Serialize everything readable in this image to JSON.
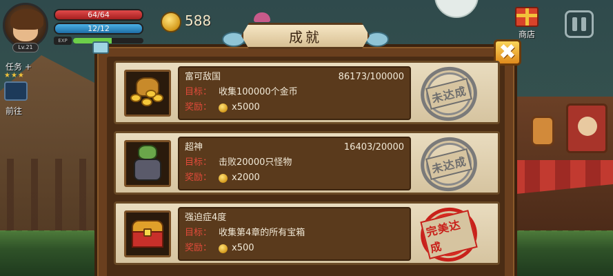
{
  "hud": {
    "level": "Lv.21",
    "hp_text": "64/64",
    "hp_fraction": 1.0,
    "mp_text": "12/12",
    "mp_fraction": 1.0,
    "exp_label": "EXP",
    "exp_fraction": 0.55,
    "coins": "588",
    "shop_label": "商店",
    "quest_label": "任务",
    "quest_add": "+",
    "stars": "★★★",
    "goto_label": "前往"
  },
  "panel": {
    "title": "成就",
    "close_glyph": "✖"
  },
  "achievements": [
    {
      "name": "富可敌国",
      "progress": "86173/100000",
      "goal_label": "目标：",
      "goal": "收集100000个金币",
      "reward_label": "奖励：",
      "reward": "x5000",
      "status": "未达成",
      "icon": "gold-pile-icon"
    },
    {
      "name": "超神",
      "progress": "16403/20000",
      "goal_label": "目标：",
      "goal": "击败20000只怪物",
      "reward_label": "奖励：",
      "reward": "x2000",
      "status": "未达成",
      "icon": "monster-icon"
    },
    {
      "name": "强迫症4度",
      "progress": "",
      "goal_label": "目标：",
      "goal": "收集第4章的所有宝箱",
      "reward_label": "奖励：",
      "reward": "x500",
      "status": "完美达成",
      "icon": "treasure-chest-icon"
    }
  ],
  "colors": {
    "hp": "#e04a4a",
    "mp": "#4ab0e4",
    "incomplete_stamp": "#7a7a7a",
    "complete_stamp": "#c8201a",
    "goal_label": "#e24a3a"
  }
}
